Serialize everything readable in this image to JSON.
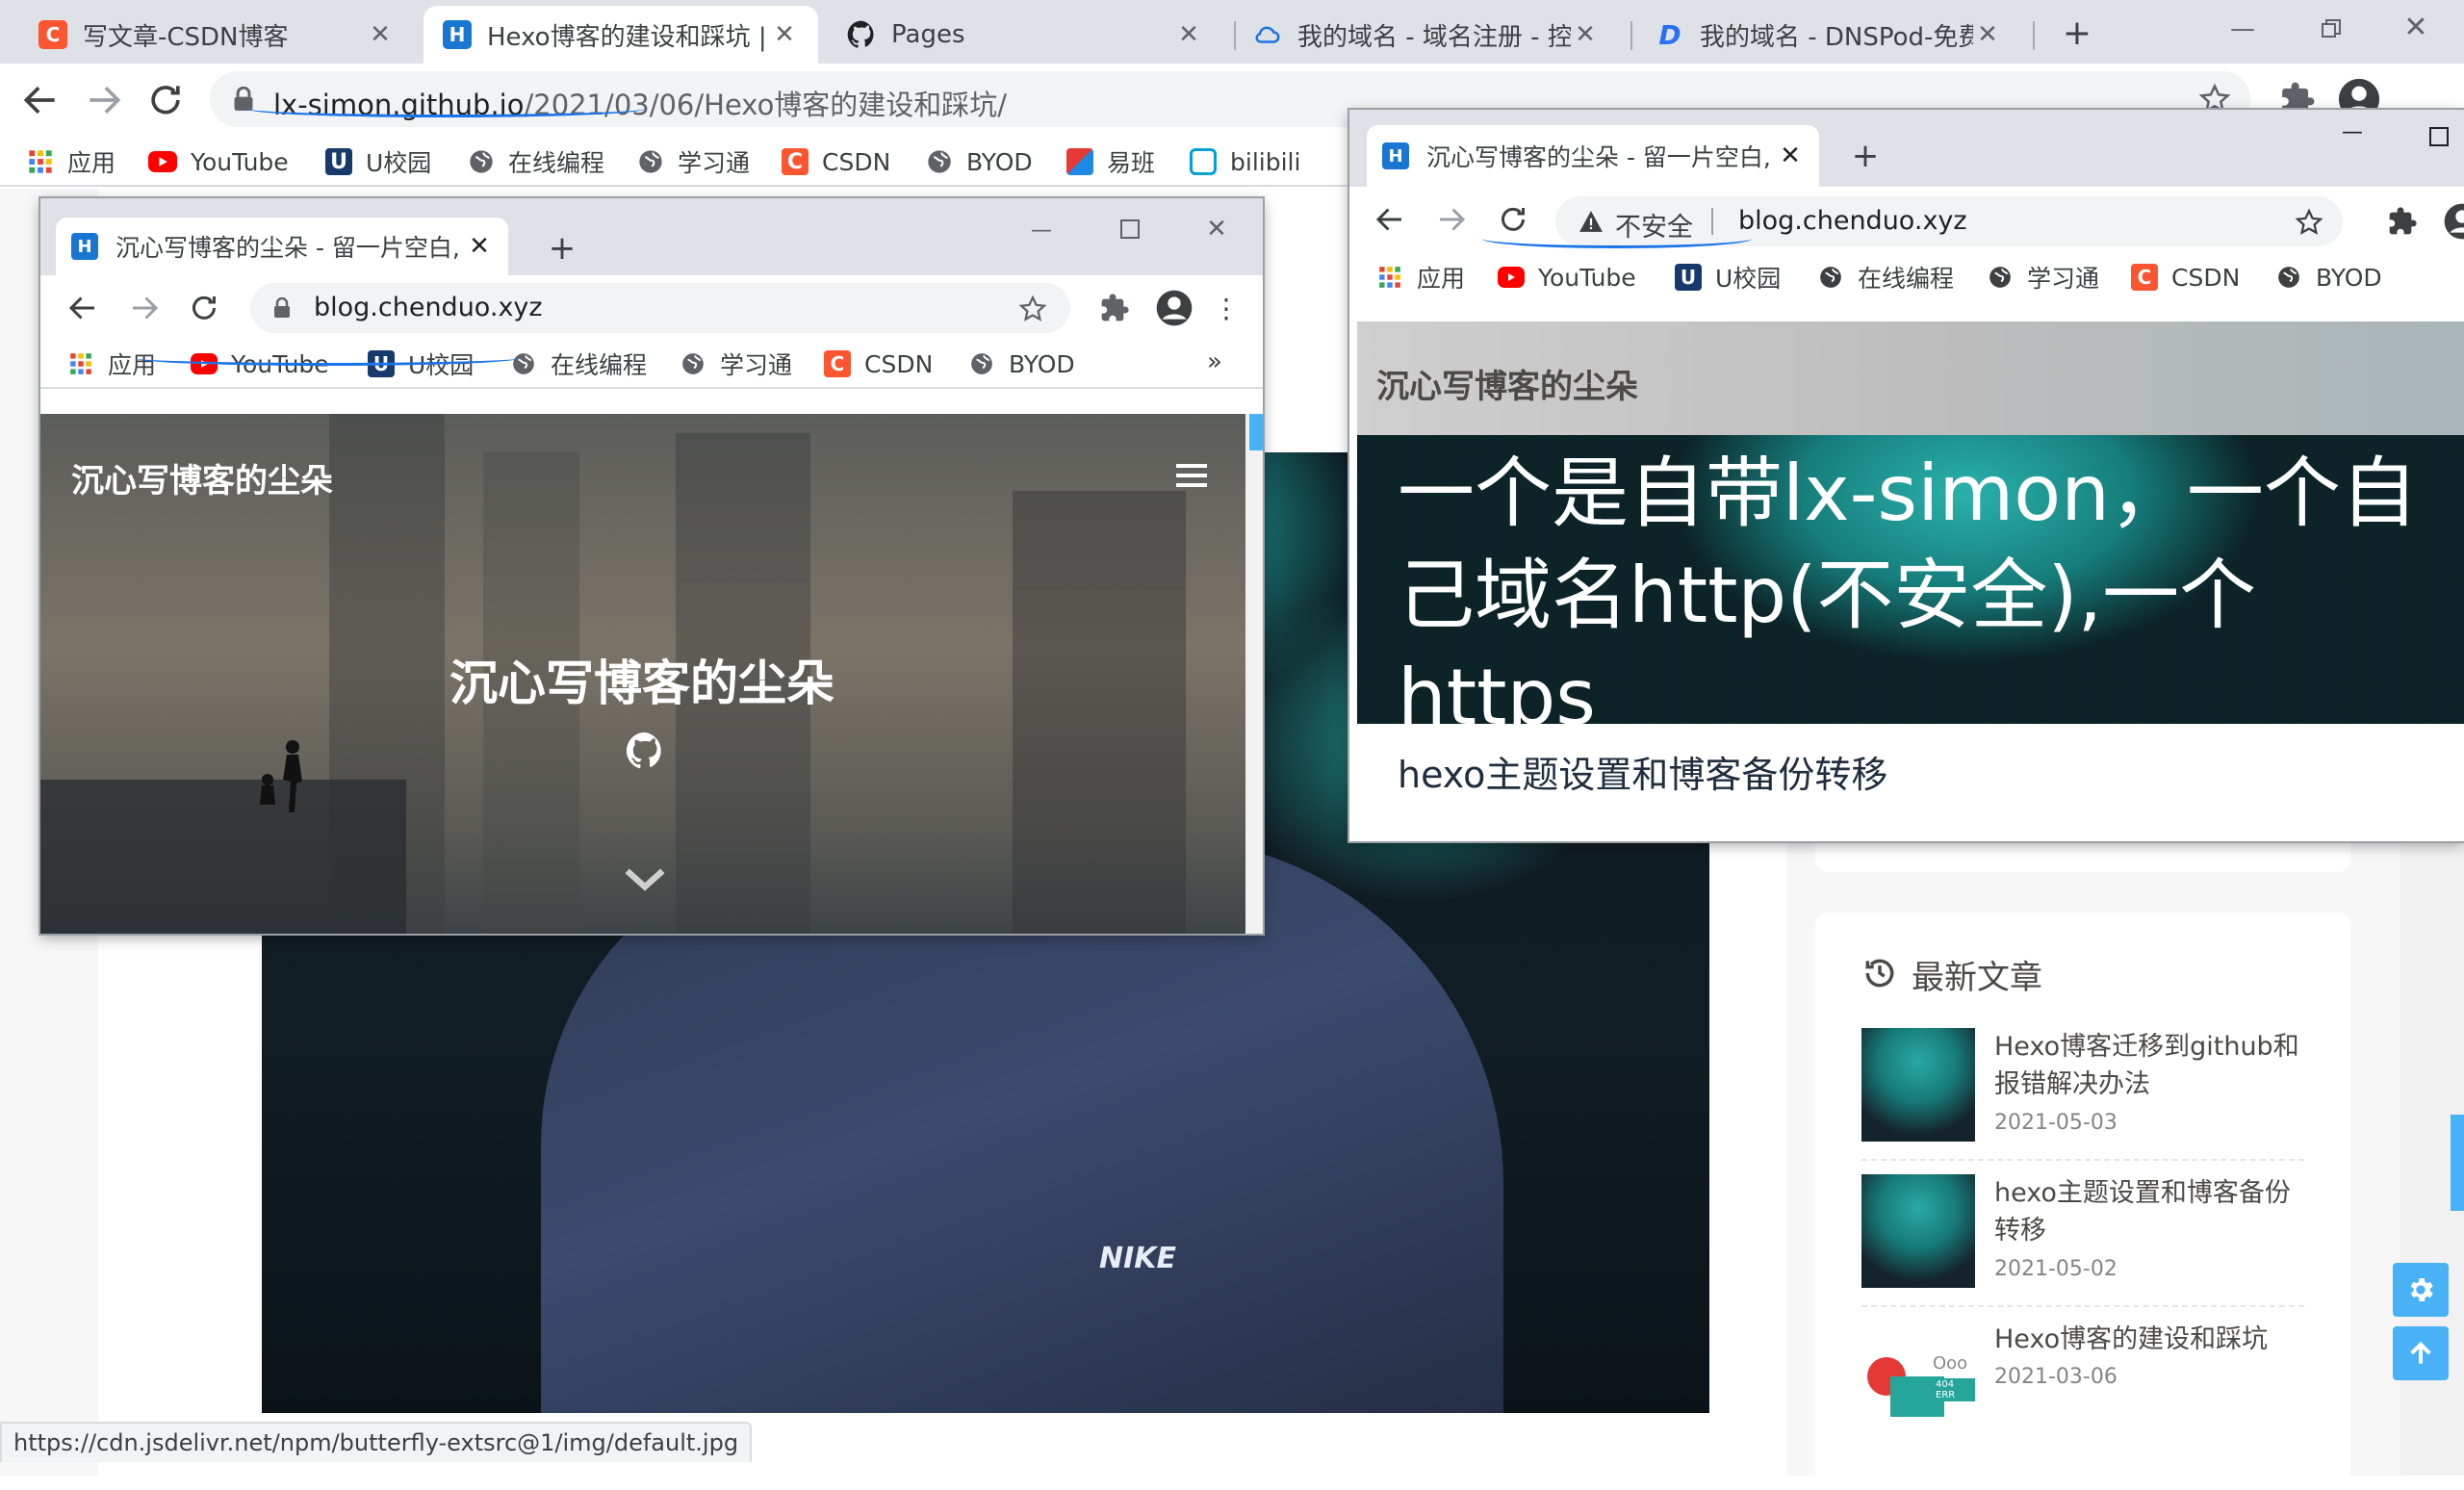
{
  "main_browser": {
    "tabs": [
      {
        "title": "写文章-CSDN博客",
        "favicon": "C",
        "favicon_color": "#fc5531"
      },
      {
        "title": "Hexo博客的建设和踩坑 | 沉",
        "favicon": "H",
        "favicon_color": "#1976d2"
      },
      {
        "title": "Pages",
        "favicon": "github-icon"
      },
      {
        "title": "我的域名 - 域名注册 - 控制",
        "favicon": "cloud-icon"
      },
      {
        "title": "我的域名 - DNSPod-免费智",
        "favicon": "D",
        "favicon_color": "#2b6ff3"
      }
    ],
    "new_tab": "+",
    "url_host": "lx-simon.github.io",
    "url_path": "/2021/03/06/Hexo博客的建设和踩坑/",
    "bookmarks": [
      {
        "label": "应用",
        "icon": "apps-grid-icon"
      },
      {
        "label": "YouTube",
        "icon": "youtube-icon"
      },
      {
        "label": "U校园",
        "icon": "u-campus-icon"
      },
      {
        "label": "在线编程",
        "icon": "globe-icon"
      },
      {
        "label": "学习通",
        "icon": "globe-icon"
      },
      {
        "label": "CSDN",
        "icon": "csdn-icon"
      },
      {
        "label": "BYOD",
        "icon": "globe-icon"
      },
      {
        "label": "易班",
        "icon": "yiban-icon"
      },
      {
        "label": "bilibili",
        "icon": "bilibili-icon"
      }
    ],
    "status_url": "https://cdn.jsdelivr.net/npm/butterfly-extsrc@1/img/default.jpg",
    "recent": {
      "heading": "最新文章",
      "posts": [
        {
          "title": "Hexo博客迁移到github和报错解决办法",
          "date": "2021-05-03"
        },
        {
          "title": "hexo主题设置和博客备份转移",
          "date": "2021-05-02"
        },
        {
          "title": "Hexo博客的建设和踩坑",
          "date": "2021-03-06"
        }
      ]
    },
    "cover_logo": "NIKE",
    "thumb_badge": "Ooo",
    "thumb_badge_sub": "404 ERR"
  },
  "popup_left": {
    "tab_title": "沉心写博客的尘朵 - 留一片空白,",
    "favicon": "H",
    "new_tab": "+",
    "url": "blog.chenduo.xyz",
    "bookmarks": [
      "应用",
      "YouTube",
      "U校园",
      "在线编程",
      "学习通",
      "CSDN",
      "BYOD"
    ],
    "more": "»",
    "site_name": "沉心写博客的尘朵",
    "hero_title": "沉心写博客的尘朵"
  },
  "popup_right": {
    "tab_title": "沉心写博客的尘朵 - 留一片空白,",
    "favicon": "H",
    "new_tab": "+",
    "security_label": "不安全",
    "url": "blog.chenduo.xyz",
    "bookmarks": [
      "应用",
      "YouTube",
      "U校园",
      "在线编程",
      "学习通",
      "CSDN",
      "BYOD"
    ],
    "site_name": "沉心写博客的尘朵",
    "annotation_text": "一个是自带lx-simon，一个自己域名http(不安全),一个https",
    "post_preview": "hexo主题设置和博客备份转移"
  },
  "colors": {
    "chrome_tabstrip": "#dee1e6",
    "accent_blue": "#49b1f5",
    "pen_blue": "#1a73e8",
    "text_dark": "#4c4948"
  }
}
